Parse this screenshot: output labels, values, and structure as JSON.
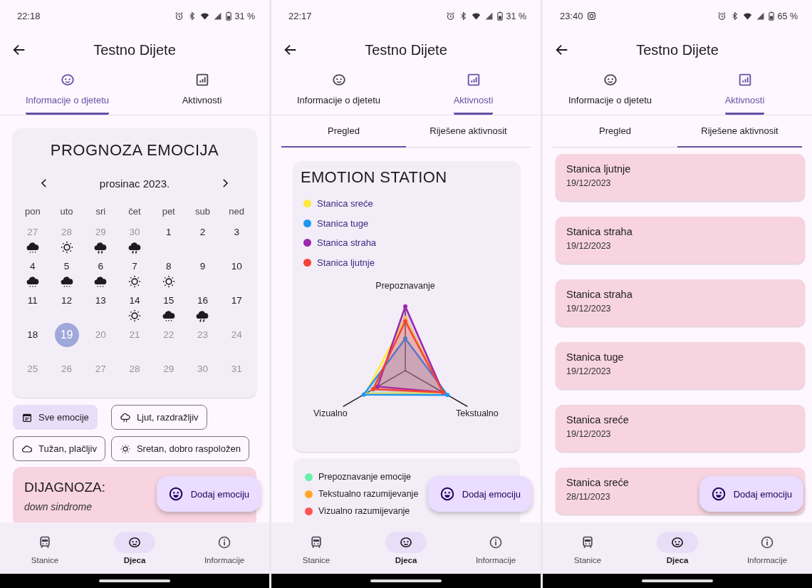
{
  "screens": [
    {
      "status_bar": {
        "time": "22:18",
        "battery": "31 %"
      },
      "app_bar": {
        "title": "Testno Dijete"
      },
      "tabs": [
        {
          "label": "Informacije o djetetu",
          "selected": true
        },
        {
          "label": "Aktivnosti",
          "selected": false
        }
      ],
      "content": {
        "kind": "calendar",
        "title": "PROGNOZA EMOCIJA",
        "month": "prosinac 2023.",
        "weekdays": [
          "pon",
          "uto",
          "sri",
          "čet",
          "pet",
          "sub",
          "ned"
        ],
        "days": [
          {
            "day": "27",
            "muted": true,
            "selected": false,
            "kind": "rain"
          },
          {
            "day": "28",
            "muted": true,
            "selected": false,
            "kind": "sun"
          },
          {
            "day": "29",
            "muted": true,
            "selected": false,
            "kind": "storm"
          },
          {
            "day": "30",
            "muted": true,
            "selected": false,
            "kind": "storm"
          },
          {
            "day": "1",
            "muted": false,
            "selected": false
          },
          {
            "day": "2",
            "muted": false,
            "selected": false
          },
          {
            "day": "3",
            "muted": false,
            "selected": false
          },
          {
            "day": "4",
            "muted": false,
            "selected": false,
            "kind": "rain"
          },
          {
            "day": "5",
            "muted": false,
            "selected": false,
            "kind": "rain"
          },
          {
            "day": "6",
            "muted": false,
            "selected": false,
            "kind": "rain"
          },
          {
            "day": "7",
            "muted": false,
            "selected": false,
            "kind": "sun"
          },
          {
            "day": "8",
            "muted": false,
            "selected": false,
            "kind": "sun"
          },
          {
            "day": "9",
            "muted": false,
            "selected": false
          },
          {
            "day": "10",
            "muted": false,
            "selected": false
          },
          {
            "day": "11",
            "muted": false,
            "selected": false
          },
          {
            "day": "12",
            "muted": false,
            "selected": false
          },
          {
            "day": "13",
            "muted": false,
            "selected": false
          },
          {
            "day": "14",
            "muted": false,
            "selected": false,
            "kind": "sun"
          },
          {
            "day": "15",
            "muted": false,
            "selected": false,
            "kind": "rain"
          },
          {
            "day": "16",
            "muted": false,
            "selected": false,
            "kind": "storm"
          },
          {
            "day": "17",
            "muted": false,
            "selected": false
          },
          {
            "day": "18",
            "muted": false,
            "selected": false
          },
          {
            "day": "19",
            "muted": false,
            "selected": true
          },
          {
            "day": "20",
            "muted": true,
            "selected": false
          },
          {
            "day": "21",
            "muted": true,
            "selected": false
          },
          {
            "day": "22",
            "muted": true,
            "selected": false
          },
          {
            "day": "23",
            "muted": true,
            "selected": false
          },
          {
            "day": "24",
            "muted": true,
            "selected": false
          },
          {
            "day": "25",
            "muted": true,
            "selected": false
          },
          {
            "day": "26",
            "muted": true,
            "selected": false
          },
          {
            "day": "27",
            "muted": true,
            "selected": false
          },
          {
            "day": "28",
            "muted": true,
            "selected": false
          },
          {
            "day": "29",
            "muted": true,
            "selected": false
          },
          {
            "day": "30",
            "muted": true,
            "selected": false
          },
          {
            "day": "31",
            "muted": true,
            "selected": false
          }
        ],
        "filters": [
          {
            "label": "Sve emocije",
            "selected": true
          },
          {
            "label": "Ljut, razdražljiv",
            "selected": false
          },
          {
            "label": "Tužan, plačljiv",
            "selected": false
          },
          {
            "label": "Sretan, dobro raspoložen",
            "selected": false
          }
        ],
        "diagnosis": {
          "title": "DIJAGNOZA:",
          "text": "down sindrome"
        }
      },
      "fab": {
        "label": "Dodaj emociju"
      },
      "bottom_nav": [
        {
          "label": "Stanice",
          "selected": false
        },
        {
          "label": "Djeca",
          "selected": true
        },
        {
          "label": "Informacije",
          "selected": false
        }
      ]
    },
    {
      "status_bar": {
        "time": "22:17",
        "battery": "31 %"
      },
      "app_bar": {
        "title": "Testno Dijete"
      },
      "tabs": [
        {
          "label": "Informacije o djetetu",
          "selected": false
        },
        {
          "label": "Aktivnosti",
          "selected": true
        }
      ],
      "content": {
        "kind": "chart",
        "sub_tabs": [
          {
            "label": "Pregled",
            "selected": true
          },
          {
            "label": "Riješene aktivnosit",
            "selected": false
          }
        ],
        "title": "EMOTION STATION",
        "legend": [
          {
            "label": "Stanica sreće",
            "color": "#ffeb3b"
          },
          {
            "label": "Stanica tuge",
            "color": "#2196f3"
          },
          {
            "label": "Stanica straha",
            "color": "#9c27b0"
          },
          {
            "label": "Stanica ljutnje",
            "color": "#f44336"
          }
        ],
        "axes": [
          "Prepoznavanje",
          "Vizualno",
          "Tekstualno"
        ],
        "categories": [
          {
            "label": "Prepoznavanje emocije",
            "color": "#69f0ae"
          },
          {
            "label": "Tekstualno razumijevanje",
            "color": "#ffa726"
          },
          {
            "label": "Vizualno razumijevanje",
            "color": "#ff5252"
          }
        ]
      },
      "fab": {
        "label": "Dodaj emociju"
      },
      "bottom_nav": [
        {
          "label": "Stanice",
          "selected": false
        },
        {
          "label": "Djeca",
          "selected": true
        },
        {
          "label": "Informacije",
          "selected": false
        }
      ]
    },
    {
      "status_bar": {
        "time": "23:40",
        "camera_notification": true,
        "battery": "65 %"
      },
      "app_bar": {
        "title": "Testno Dijete"
      },
      "tabs": [
        {
          "label": "Informacije o djetetu",
          "selected": false
        },
        {
          "label": "Aktivnosti",
          "selected": true
        }
      ],
      "content": {
        "kind": "list",
        "sub_tabs": [
          {
            "label": "Pregled",
            "selected": false
          },
          {
            "label": "Riješene aktivnosit",
            "selected": true
          }
        ],
        "items": [
          {
            "title": "Stanica ljutnje",
            "date": "19/12/2023"
          },
          {
            "title": "Stanica straha",
            "date": "19/12/2023"
          },
          {
            "title": "Stanica straha",
            "date": "19/12/2023"
          },
          {
            "title": "Stanica tuge",
            "date": "19/12/2023"
          },
          {
            "title": "Stanica sreće",
            "date": "19/12/2023"
          },
          {
            "title": "Stanica sreće",
            "date": "28/11/2023"
          }
        ]
      },
      "fab": {
        "label": "Dodaj emociju"
      },
      "bottom_nav": [
        {
          "label": "Stanice",
          "selected": false
        },
        {
          "label": "Djeca",
          "selected": true
        },
        {
          "label": "Informacije",
          "selected": false
        }
      ]
    }
  ]
}
